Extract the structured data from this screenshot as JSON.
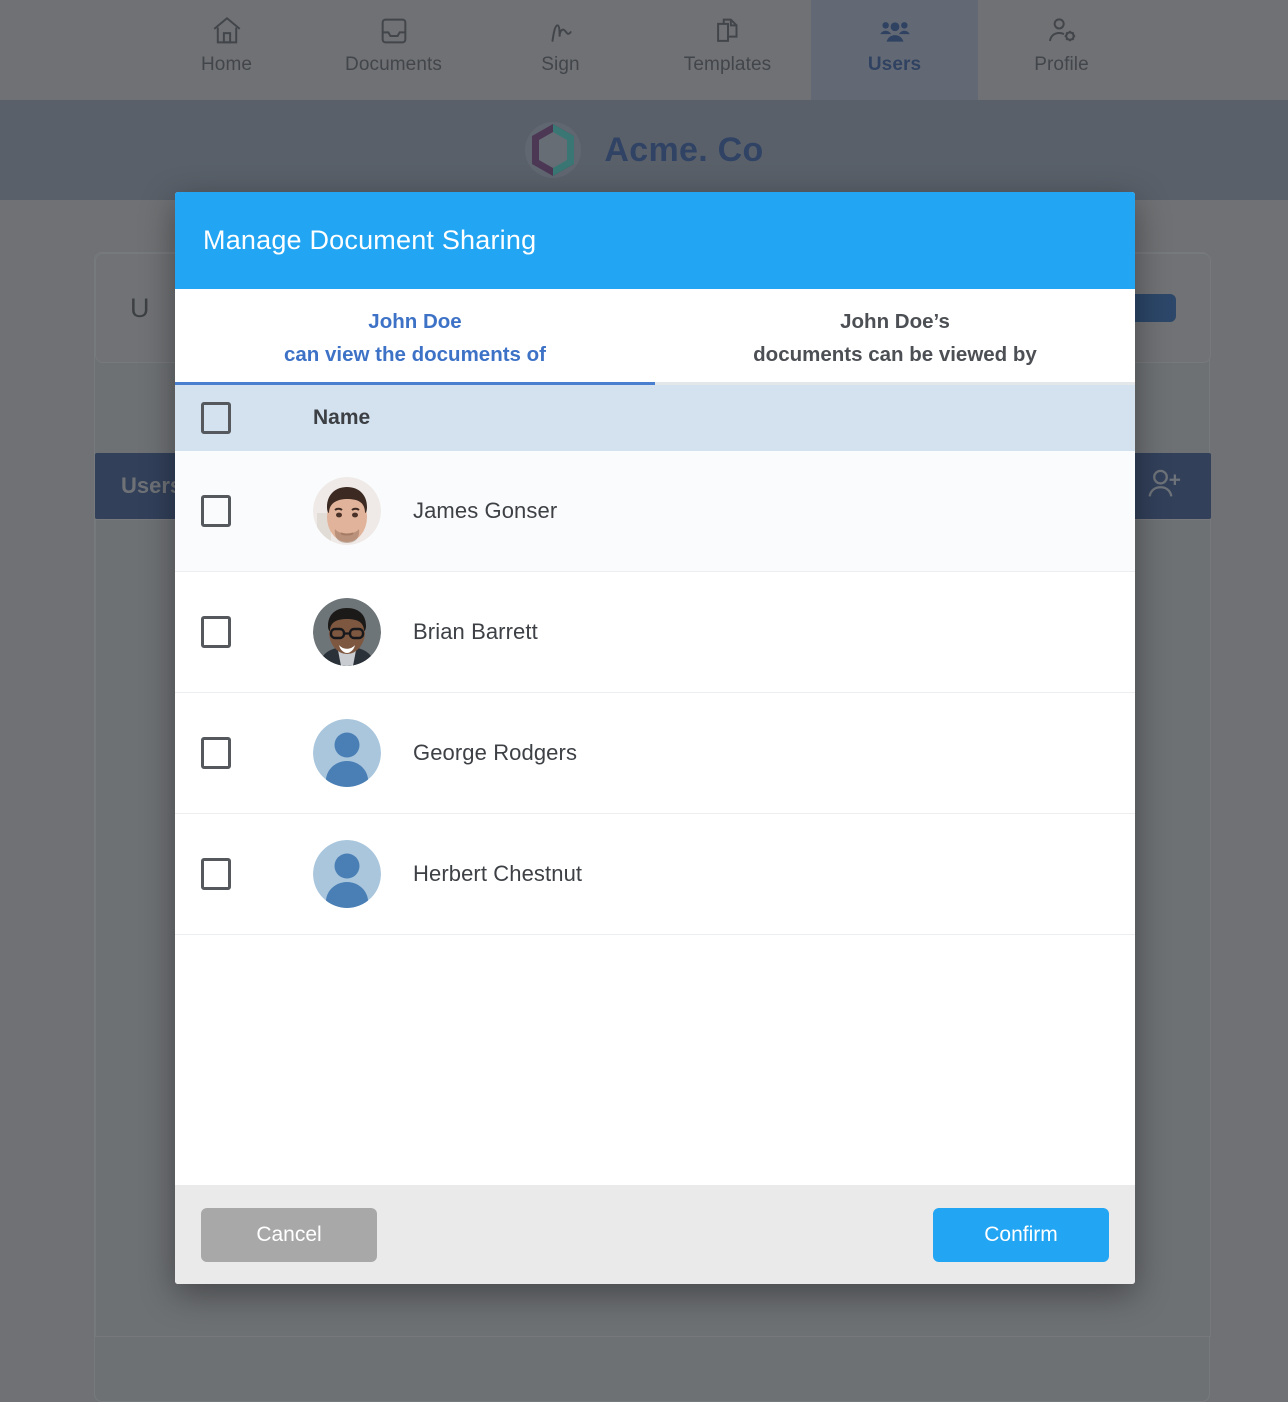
{
  "nav": {
    "items": [
      {
        "label": "Home",
        "icon": "home-icon",
        "active": false
      },
      {
        "label": "Documents",
        "icon": "inbox-icon",
        "active": false
      },
      {
        "label": "Sign",
        "icon": "signature-icon",
        "active": false
      },
      {
        "label": "Templates",
        "icon": "copy-documents-icon",
        "active": false
      },
      {
        "label": "Users",
        "icon": "users-group-icon",
        "active": true
      },
      {
        "label": "Profile",
        "icon": "user-gear-icon",
        "active": false
      }
    ]
  },
  "org": {
    "name": "Acme. Co",
    "logo_icon": "hexagon-logo-icon",
    "logo_color_left": "#4a2a55",
    "logo_color_right": "#2e8b84"
  },
  "background": {
    "card_title": "U",
    "card_button_label": "",
    "toolbar_title": "Users",
    "add_user_icon": "add-user-icon"
  },
  "modal": {
    "title": "Manage Document Sharing",
    "header_color": "#22a5f2",
    "tabs": [
      {
        "line1": "John Doe",
        "line2": "can view the documents of",
        "active": true
      },
      {
        "line1": "John Doe’s",
        "line2": "documents can be viewed by",
        "active": false
      }
    ],
    "table": {
      "header_bg": "#d3e2ee",
      "select_all_checked": false,
      "columns": [
        "",
        "",
        "Name"
      ],
      "name_header": "Name",
      "rows": [
        {
          "name": "James Gonser",
          "checked": false,
          "avatar_type": "photo-male-1"
        },
        {
          "name": "Brian Barrett",
          "checked": false,
          "avatar_type": "photo-male-2"
        },
        {
          "name": "George Rodgers",
          "checked": false,
          "avatar_type": "placeholder"
        },
        {
          "name": "Herbert Chestnut",
          "checked": false,
          "avatar_type": "placeholder"
        }
      ]
    },
    "footer": {
      "cancel_label": "Cancel",
      "confirm_label": "Confirm",
      "cancel_color": "#a8a8a8",
      "confirm_color": "#22a5f2"
    }
  }
}
